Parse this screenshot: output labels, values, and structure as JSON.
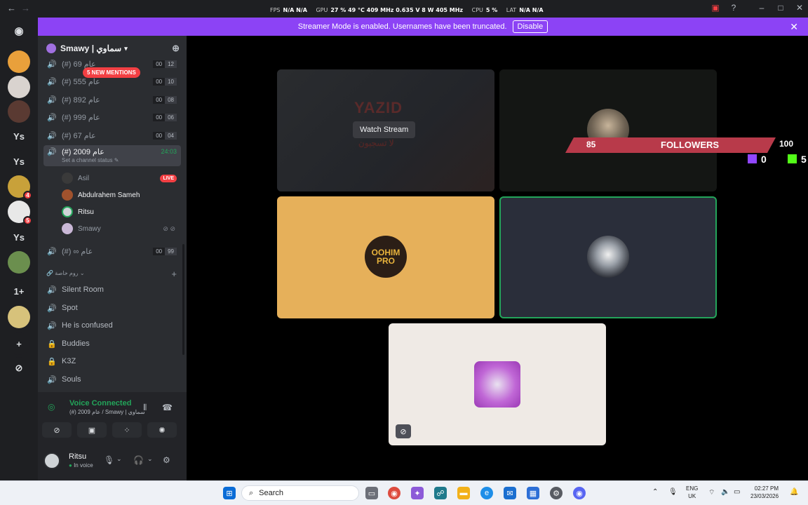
{
  "titlebar": {
    "title": "Smawy | سماوي",
    "overlay": [
      {
        "label": "FPS",
        "value": "N/A  N/A"
      },
      {
        "label": "GPU",
        "value": "27 %  49 °C  409 MHz  0.635 V  8 W  405 MHz"
      },
      {
        "label": "CPU",
        "value": "5 %"
      },
      {
        "label": "LAT",
        "value": "N/A  N/A"
      }
    ]
  },
  "banner": {
    "text": "Streamer Mode is enabled. Usernames have been truncated.",
    "button": "Disable"
  },
  "rail": {
    "servers": [
      {
        "text": "",
        "color": "#e9a03b",
        "badge": ""
      },
      {
        "text": "",
        "color": "#d9d3cf",
        "badge": ""
      },
      {
        "text": "",
        "color": "#5a3a32",
        "badge": ""
      },
      {
        "text": "Ys",
        "color": "#1e1f22",
        "badge": ""
      },
      {
        "text": "Ys",
        "color": "#1e1f22",
        "badge": ""
      },
      {
        "text": "",
        "color": "#c8a13a",
        "badge": "4"
      },
      {
        "text": "",
        "color": "#e8e8e8",
        "badge": "5"
      },
      {
        "text": "Ys",
        "color": "#1e1f22",
        "badge": ""
      },
      {
        "text": "",
        "color": "#6b8f4e",
        "badge": ""
      },
      {
        "text": "1+",
        "color": "#1e1f22",
        "badge": ""
      },
      {
        "text": "",
        "color": "#d7c27b",
        "badge": ""
      },
      {
        "text": "+",
        "color": "#1e1f22",
        "badge": ""
      },
      {
        "text": "⊘",
        "color": "#1e1f22",
        "badge": ""
      }
    ]
  },
  "sidebar": {
    "server_name": "Smawy | سماوي",
    "mentions": "5 NEW MENTIONS",
    "channels": [
      {
        "name": "(#) 69 عام",
        "a": "00",
        "b": "12"
      },
      {
        "name": "(#) 555 عام",
        "a": "00",
        "b": "10"
      },
      {
        "name": "(#) 892 عام",
        "a": "00",
        "b": "08"
      },
      {
        "name": "(#) 999 عام",
        "a": "00",
        "b": "06"
      },
      {
        "name": "(#) 67 عام",
        "a": "00",
        "b": "04"
      }
    ],
    "active_channel": {
      "name": "(#) 2009 عام",
      "timer": "24:03",
      "status": "Set a channel status"
    },
    "users": [
      {
        "name": "Asil",
        "live": "LIVE"
      },
      {
        "name": "Abdulrahem Sameh",
        "live": ""
      },
      {
        "name": "Ritsu",
        "live": ""
      },
      {
        "name": "Smawy",
        "live": ""
      }
    ],
    "inf_channel": {
      "name": "(#) ∞ عام",
      "a": "00",
      "b": "99"
    },
    "category": "روم خاصة",
    "private_channels": [
      {
        "name": "Silent Room",
        "icon": "speaker"
      },
      {
        "name": "Spot",
        "icon": "speaker"
      },
      {
        "name": "He is confused",
        "icon": "speaker"
      },
      {
        "name": "Buddies",
        "icon": "lock"
      },
      {
        "name": "K3Z",
        "icon": "lock"
      },
      {
        "name": "Souls",
        "icon": "speaker"
      }
    ]
  },
  "voice": {
    "title": "Voice Connected",
    "subtitle": "(#) 2009 عام / Smawy | سماوي"
  },
  "user": {
    "name": "Ritsu",
    "status": "In voice"
  },
  "stage": {
    "watch_label": "Watch Stream",
    "stream_text": "YAZID",
    "stream_arabic": "لا تسجبون",
    "tile3_text": [
      "OOHIM",
      "PRO"
    ],
    "followers": {
      "label": "FOLLOWERS",
      "current": "85",
      "goal": "100",
      "twitch": "0",
      "kick": "5"
    }
  },
  "taskbar": {
    "search": "Search",
    "lang_top": "ENG",
    "lang_bottom": "UK",
    "time": "02:27 PM",
    "date": "23/03/2026"
  }
}
